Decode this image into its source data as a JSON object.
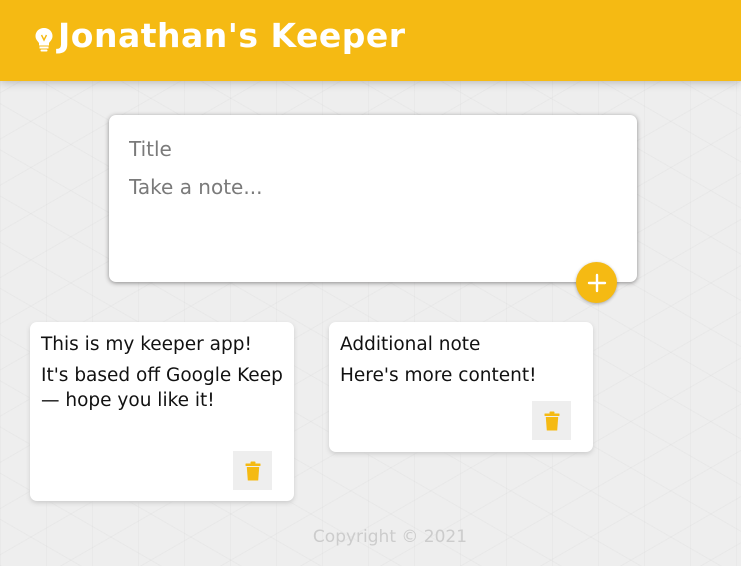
{
  "header": {
    "title": "Jonathan's Keeper",
    "icon": "lightbulb-icon",
    "background": "#f5ba13"
  },
  "create_note": {
    "title_placeholder": "Title",
    "content_placeholder": "Take a note...",
    "add_icon": "plus-icon"
  },
  "notes": [
    {
      "title": "This is my keeper app!",
      "content": "It's based off Google Keep — hope you like it!",
      "delete_icon": "trash-icon"
    },
    {
      "title": "Additional note",
      "content": "Here's more content!",
      "delete_icon": "trash-icon"
    }
  ],
  "footer": {
    "copyright": "Copyright © 2021"
  },
  "colors": {
    "accent": "#f5ba13",
    "card": "#ffffff",
    "background": "#eeeeee"
  }
}
